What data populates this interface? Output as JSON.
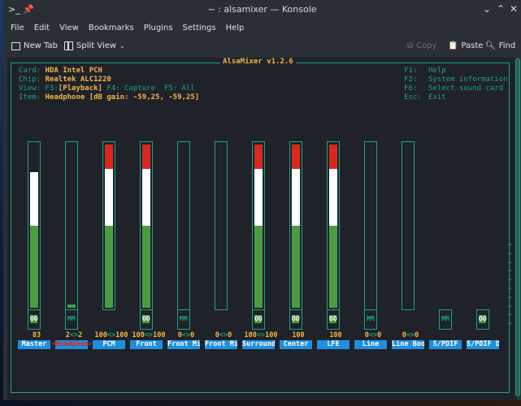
{
  "window": {
    "title": "~ : alsamixer — Konsole",
    "controls": [
      "minimize",
      "maximize",
      "close"
    ]
  },
  "menubar": [
    "File",
    "Edit",
    "View",
    "Bookmarks",
    "Plugins",
    "Settings",
    "Help"
  ],
  "toolbar": {
    "new_tab": "New Tab",
    "split_view": "Split View",
    "copy": "Copy",
    "paste": "Paste",
    "find": "Find"
  },
  "alsamixer": {
    "title": "AlsaMixer v1.2.6",
    "info": [
      {
        "key": "Card:",
        "value": "HDA Intel PCH"
      },
      {
        "key": "Chip:",
        "value": "Realtek ALC1220"
      },
      {
        "key": "View:",
        "value_parts": [
          "F3:",
          "[Playback]",
          " F4: Capture  F5: All"
        ]
      },
      {
        "key": "Item:",
        "value": "Headphone [dB gain: -59,25, -59,25]"
      }
    ],
    "keys": [
      {
        "key": "F1:",
        "desc": "Help"
      },
      {
        "key": "F2:",
        "desc": "System information"
      },
      {
        "key": "F6:",
        "desc": "Select sound card"
      },
      {
        "key": "Esc:",
        "desc": "Exit"
      }
    ],
    "colors": {
      "border": "#1da384",
      "value_text": "#f0b64a",
      "label_bg": "#1e8fe0",
      "selected_label_text": "#d9291f",
      "level_green": "#4e9a43",
      "level_white": "#ffffff",
      "level_red": "#d9291f"
    },
    "controls": [
      {
        "name": "Master",
        "value": "83",
        "level": 0.83,
        "has_bar": true,
        "switch": "OO",
        "selected": false
      },
      {
        "name": "Headphon",
        "value": "2<>2",
        "level": 0.02,
        "has_bar": true,
        "switch": "MM",
        "selected": true
      },
      {
        "name": "PCM",
        "value": "100<>100",
        "level": 1.0,
        "has_bar": true,
        "bar_short": true,
        "switch": null,
        "selected": false
      },
      {
        "name": "Front",
        "value": "100<>100",
        "level": 1.0,
        "has_bar": true,
        "switch": "OO",
        "selected": false
      },
      {
        "name": "Front Mi",
        "value": "0<>0",
        "level": 0.0,
        "has_bar": true,
        "switch": "MM",
        "selected": false
      },
      {
        "name": "Front Mi",
        "value": "0<>0",
        "level": 0.0,
        "has_bar": true,
        "bar_short": true,
        "switch": null,
        "selected": false
      },
      {
        "name": "Surround",
        "value": "100<>100",
        "level": 1.0,
        "has_bar": true,
        "switch": "OO",
        "selected": false
      },
      {
        "name": "Center",
        "value": "100",
        "level": 1.0,
        "has_bar": true,
        "switch": "OO",
        "selected": false
      },
      {
        "name": "LFE",
        "value": "100",
        "level": 1.0,
        "has_bar": true,
        "switch": "OO",
        "selected": false
      },
      {
        "name": "Line",
        "value": "0<>0",
        "level": 0.0,
        "has_bar": true,
        "switch": "MM",
        "selected": false
      },
      {
        "name": "Line Boo",
        "value": "0<>0",
        "level": 0.0,
        "has_bar": true,
        "bar_short": true,
        "switch": null,
        "selected": false
      },
      {
        "name": "S/PDIF",
        "value": "",
        "level": null,
        "has_bar": false,
        "switch": "MM",
        "selected": false
      },
      {
        "name": "S/PDIF D",
        "value": "",
        "level": null,
        "has_bar": false,
        "switch": "OO",
        "selected": false
      }
    ],
    "scroll_arrow": "→"
  }
}
